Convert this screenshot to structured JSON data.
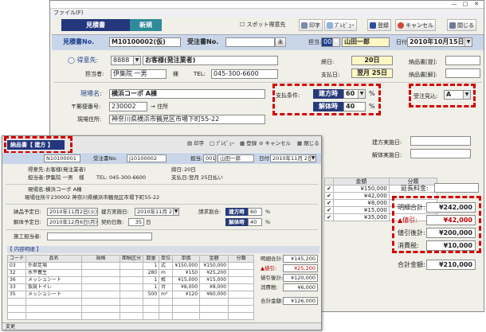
{
  "main": {
    "menu": "ファイル(F)",
    "tabs": [
      "見積書",
      "新規"
    ],
    "spot_checkbox": "スポット得意先",
    "toolbar": {
      "print": "印字",
      "preview": "ﾌﾟﾚﾋﾞｭｰ",
      "register": "登録",
      "cancel": "キャンセル",
      "close": "閉じる"
    },
    "header": {
      "estimate_no_label": "見積書No.",
      "estimate_no": "M10100002(仮)",
      "order_no_label": "受注書No.",
      "order_btn": "未",
      "staff_label": "担当:",
      "staff_code": "001",
      "staff_name": "山田一郎",
      "date_label": "日付:",
      "date": "2010年10月15日"
    },
    "customer": {
      "label": "得意先:",
      "code": "8888",
      "name": "お客様(発注業者)",
      "person_label": "担当者:",
      "person": "伊集院 一男",
      "sama": "様",
      "tel_label": "TEL:",
      "tel": "045-300-6600",
      "close_label": "締日:",
      "close_value": "20日",
      "pay_label": "支払日:",
      "pay_value": "翌月 25日",
      "delivery_label": "納品書[提]:",
      "delivery_issue_label": "納品書[解]:",
      "star": "☆"
    },
    "site": {
      "name_label": "現場名:",
      "name": "横浜コーポ A棟",
      "zip_label": "〒郵便番号:",
      "zip": "230002",
      "addr_btn": "→ 住所",
      "addr_label": "現場住所:",
      "addr": "神奈川県横浜市鶴見区市場下町55-22"
    },
    "payment": {
      "label": "支払条件:",
      "build_label": "建方時",
      "build_pct": "60",
      "dismantle_label": "解体時",
      "dismantle_pct": "40",
      "pct_sign": "%"
    },
    "order_prospect": {
      "label": "受注見込:",
      "value": "A"
    },
    "dates_right": {
      "build_label": "建方実施日:",
      "dismantle_label": "解体実施日:"
    },
    "grid": {
      "headers": [
        "",
        "金額",
        "分類"
      ],
      "rows": [
        [
          "✔",
          "¥150,000"
        ],
        [
          "✔",
          "¥42,000"
        ],
        [
          "✔",
          "¥8,000"
        ],
        [
          "✔",
          "¥15,000"
        ],
        [
          "✔",
          "¥35,000"
        ]
      ]
    },
    "extension_label": "延長料金:",
    "totals": [
      {
        "label": "明細合計:",
        "value": "¥242,000",
        "red": false
      },
      {
        "label": "▲値引:",
        "value": "¥42,000",
        "red": true
      },
      {
        "label": "値引後計:",
        "value": "¥200,000",
        "red": false
      },
      {
        "label": "消費税:",
        "value": "¥10,000",
        "red": false
      }
    ],
    "grand_total": {
      "label": "合計金額:",
      "value": "¥210,000"
    }
  },
  "sub": {
    "title": "納品書【 建方 】",
    "toolbar": {
      "print": "印字",
      "preview": "ﾌﾟﾚﾋﾞｭｰ",
      "register": "登録",
      "cancel": "キャンセル",
      "close": "閉じる"
    },
    "header": {
      "no": "N10100001",
      "order_no_label": "受注書No.",
      "order_no": "J10100002",
      "staff_label": "担当:",
      "staff_code": "001",
      "staff_name": "山田一郎",
      "date_label": "日付:",
      "date": "2010年11月 2日"
    },
    "customer": {
      "label": "得意先:",
      "name": "お客様(発注業者)",
      "person_label": "担当者:",
      "person": "伊集院 一男",
      "sama": "様",
      "tel_label": "TEL:",
      "tel": "045-300-6600",
      "close_label": "締日:",
      "close_value": "20日",
      "pay_label": "支払日:",
      "pay_value": "翌月 25日払い"
    },
    "site": {
      "name_label": "現場名:",
      "name": "横浜コーポ A棟",
      "addr_label": "現場住所:",
      "addr": "〒230002 神奈川県横浜市鶴見区市場下町55-22"
    },
    "delivery": {
      "plan_label": "納品予定日:",
      "plan_date": "2010年11月2日(火)",
      "build_label": "建方実施日:",
      "build_date": "2010年11月 2日",
      "dismantle_plan_label": "解体予定日:",
      "dismantle_plan_date": "2010年12月6日(月)",
      "days_label": "契約日数:",
      "days": "35",
      "days_unit": "日",
      "bill_label": "請求割合:",
      "bill_build": "建方時",
      "bill_build_pct": "60",
      "bill_dismantle": "解体時",
      "bill_dismantle_pct": "40",
      "pct": "%"
    },
    "contractor_label": "施工担当者:",
    "details_label": "【 内容明細 】",
    "detail_headers": [
      "コード",
      "品名",
      "規格",
      "面積区分",
      "数量",
      "単位",
      "単価",
      "金額",
      "分類"
    ],
    "detail_rows": [
      [
        "03",
        "外部足場",
        "",
        "",
        "1",
        "式",
        "¥150,000",
        "¥150,000",
        ""
      ],
      [
        "32",
        "水平養生",
        "",
        "",
        "280",
        "m",
        "¥150",
        "¥25,200",
        ""
      ],
      [
        "36",
        "メッシュシート",
        "",
        "",
        "1",
        "枚",
        "¥15,000",
        "¥15,000",
        ""
      ],
      [
        "33",
        "仮設トイレ",
        "",
        "",
        "1",
        "台",
        "¥8,000",
        "¥8,000",
        ""
      ],
      [
        "35",
        "メッシュシート",
        "",
        "",
        "500",
        "m²",
        "¥120",
        "¥60,000",
        ""
      ]
    ],
    "totals": [
      {
        "label": "明細合計:",
        "value": "¥145,200",
        "red": false
      },
      {
        "label": "▲値引:",
        "value": "¥25,200",
        "red": true
      },
      {
        "label": "値引後計:",
        "value": "¥120,000",
        "red": false
      },
      {
        "label": "消費税:",
        "value": "¥6,000",
        "red": false
      }
    ],
    "grand_total": {
      "label": "合計金額:",
      "value": "¥126,000"
    },
    "status": "変更"
  }
}
